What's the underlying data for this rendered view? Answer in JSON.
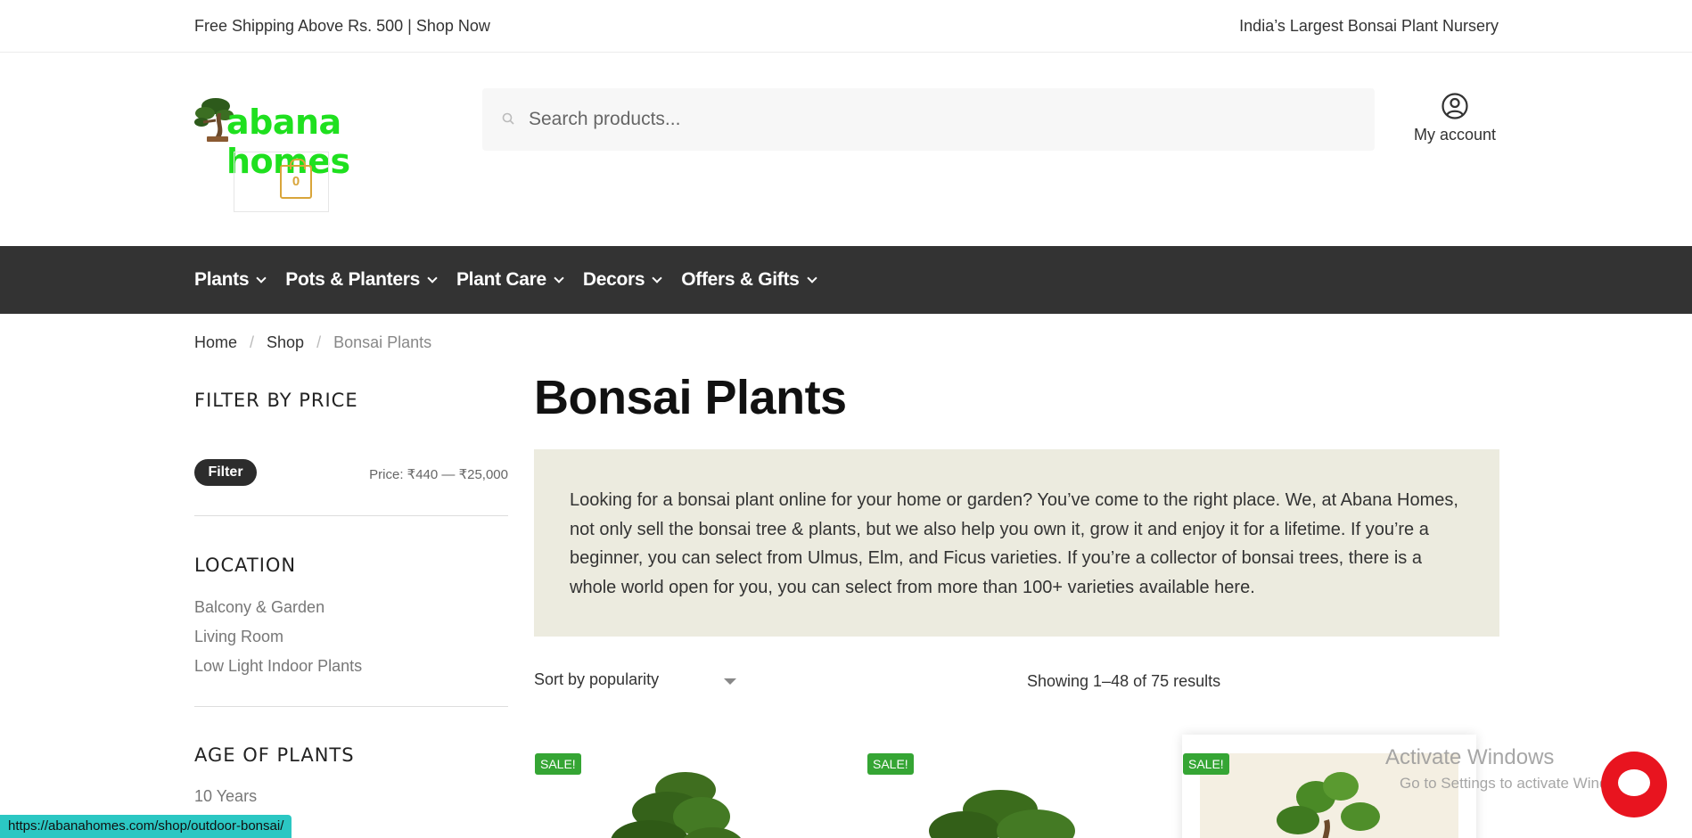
{
  "topbar": {
    "left_text": "Free Shipping Above Rs. 500 | Shop Now",
    "right_text": "India’s Largest Bonsai Plant Nursery"
  },
  "header": {
    "logo_text": "abana homes",
    "cart_count": "0",
    "search_placeholder": "Search products...",
    "account_label": "My account"
  },
  "nav": {
    "items": [
      {
        "label": "Plants"
      },
      {
        "label": "Pots & Planters"
      },
      {
        "label": "Plant Care"
      },
      {
        "label": "Decors"
      },
      {
        "label": "Offers & Gifts"
      }
    ]
  },
  "breadcrumb": {
    "home": "Home",
    "shop": "Shop",
    "current": "Bonsai Plants"
  },
  "sidebar": {
    "price_title": "FILTER BY PRICE",
    "filter_button": "Filter",
    "price_label": "Price: ₹440 — ₹25,000",
    "location_title": "LOCATION",
    "locations": [
      "Balcony & Garden",
      "Living Room",
      "Low Light Indoor Plants"
    ],
    "age_title": "AGE OF PLANTS",
    "ages": [
      "10 Years"
    ]
  },
  "main": {
    "title": "Bonsai Plants",
    "description": "Looking for a bonsai plant online for your home or garden? You’ve come to the right place. We, at Abana Homes, not only sell the bonsai tree & plants, but we also help you own it, grow it and enjoy it for a lifetime. If you’re a beginner, you can select from Ulmus, Elm, and Ficus varieties. If you’re a collector of bonsai trees, there is a whole world open for you, you can select from more than 100+ varieties available here.",
    "sort_label": "Sort by popularity",
    "results_text": "Showing 1–48 of 75 results",
    "products": [
      {
        "badge": "SALE!"
      },
      {
        "badge": "SALE!"
      },
      {
        "badge": "SALE!"
      }
    ]
  },
  "overlay": {
    "activate_title": "Activate Windows",
    "activate_sub": "Go to Settings to activate Windows.",
    "status_url": "https://abanahomes.com/shop/outdoor-bonsai/"
  },
  "colors": {
    "nav_bg": "#333333",
    "logo_green": "#1fe01f",
    "cart_accent": "#d9a53a",
    "sale_badge": "#35a534",
    "description_bg": "#ecebdf",
    "chat_button": "#e8141f",
    "status_bar": "#2bc7c3"
  }
}
